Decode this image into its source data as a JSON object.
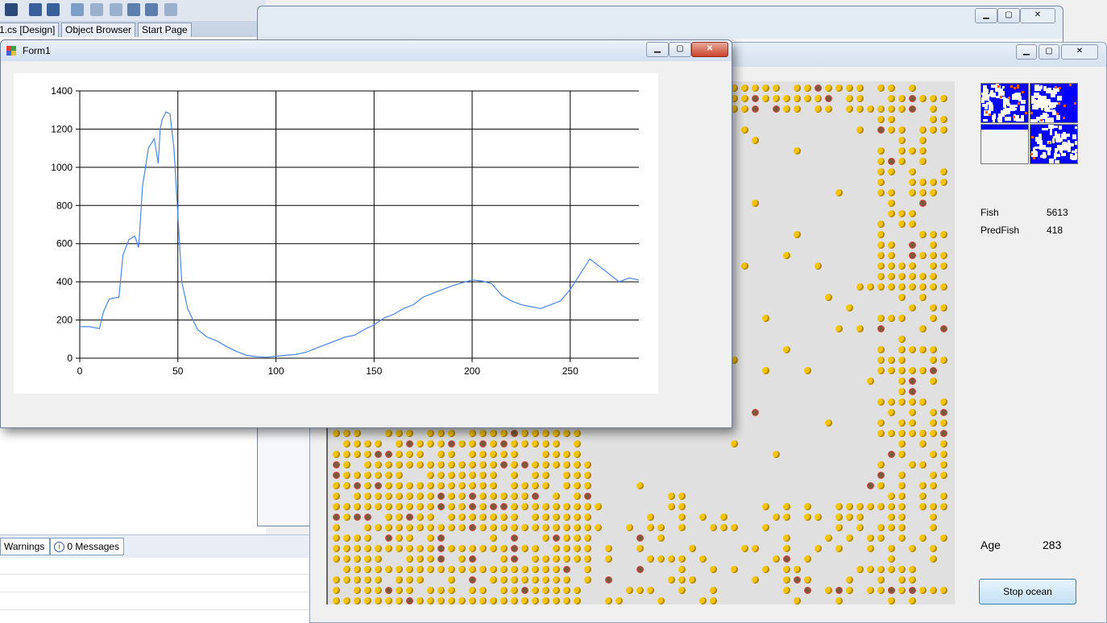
{
  "vs": {
    "tabs": [
      "1.cs [Design]",
      "Object Browser",
      "Start Page"
    ],
    "error_list": {
      "warnings_label": "Warnings",
      "messages_label": "0 Messages"
    }
  },
  "ocean_window": {
    "stats": {
      "fish_label": "Fish",
      "fish_value": "5613",
      "predfish_label": "PredFish",
      "predfish_value": "418",
      "age_label": "Age",
      "age_value": "283"
    },
    "stop_button_label": "Stop ocean"
  },
  "form1": {
    "title": "Form1",
    "chart_data": {
      "type": "line",
      "title": "",
      "xlabel": "",
      "ylabel": "",
      "xlim": [
        0,
        285
      ],
      "ylim": [
        0,
        1400
      ],
      "x_ticks": [
        0,
        50,
        100,
        150,
        200,
        250
      ],
      "y_ticks": [
        0,
        200,
        400,
        600,
        800,
        1000,
        1200,
        1400
      ],
      "grid": true,
      "line_color": "#4a86e8",
      "series": [
        {
          "x": [
            0,
            5,
            10,
            12,
            15,
            20,
            22,
            25,
            28,
            30,
            32,
            35,
            38,
            40,
            41,
            42,
            44,
            46,
            48,
            50,
            52,
            55,
            60,
            65,
            70,
            75,
            80,
            85,
            90,
            95,
            100,
            105,
            110,
            115,
            120,
            125,
            130,
            135,
            140,
            145,
            150,
            155,
            160,
            165,
            170,
            175,
            180,
            185,
            190,
            195,
            200,
            205,
            210,
            215,
            220,
            225,
            230,
            235,
            240,
            245,
            250,
            255,
            260,
            265,
            270,
            275,
            280,
            285
          ],
          "y": [
            165,
            165,
            155,
            240,
            310,
            320,
            540,
            620,
            640,
            580,
            900,
            1100,
            1150,
            1020,
            1200,
            1250,
            1290,
            1280,
            1100,
            750,
            400,
            260,
            150,
            110,
            90,
            60,
            35,
            15,
            8,
            5,
            10,
            15,
            20,
            30,
            50,
            70,
            90,
            110,
            120,
            150,
            175,
            210,
            230,
            260,
            280,
            320,
            340,
            360,
            380,
            395,
            410,
            405,
            390,
            330,
            300,
            280,
            270,
            260,
            280,
            300,
            360,
            440,
            520,
            480,
            440,
            400,
            420,
            410
          ]
        }
      ]
    }
  },
  "colors": {
    "grid_line": "#000000",
    "fish": "#f5c400",
    "predator": "#7a5a3a",
    "minimap_water": "#0000ff"
  }
}
